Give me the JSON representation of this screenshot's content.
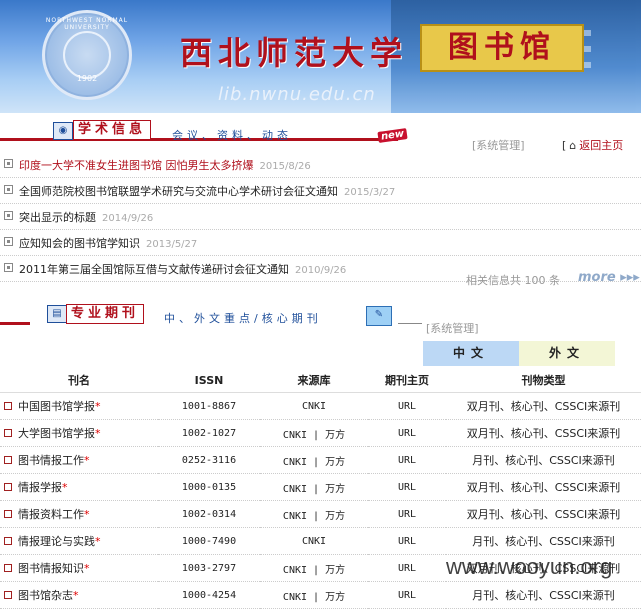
{
  "banner": {
    "title": "西北师范大学",
    "library": "图书馆",
    "url": "lib.nwnu.edu.cn",
    "seal_ring": "NORTHWEST NORMAL UNIVERSITY",
    "seal_year": "1902"
  },
  "news_section": {
    "title": "学术信息",
    "subtitle": "会议、资料、动态",
    "badge": "new",
    "sysadmin": "[系统管理]",
    "home_bracket": "[",
    "home": "返回主页",
    "items": [
      {
        "title": "印度一大学不准女生进图书馆 因怕男生太多挤爆",
        "date": "2015/8/26",
        "hot": true
      },
      {
        "title": "全国师范院校图书馆联盟学术研究与交流中心学术研讨会征文通知",
        "date": "2015/3/27",
        "hot": false
      },
      {
        "title": "突出显示的标题",
        "date": "2014/9/26",
        "hot": false
      },
      {
        "title": "应知知会的图书馆学知识",
        "date": "2013/5/27",
        "hot": false
      },
      {
        "title": "2011年第三届全国馆际互借与文献传递研讨会征文通知",
        "date": "2010/9/26",
        "hot": false
      }
    ],
    "total_label": "相关信息共 100 条",
    "more": "more ▸▸▸"
  },
  "journal_section": {
    "title": "专业期刊",
    "subtitle": "中、外文重点/核心期刊",
    "sysadmin": "[系统管理]",
    "tab_cn": "中文",
    "tab_en": "外文",
    "headers": [
      "刊名",
      "ISSN",
      "来源库",
      "期刊主页",
      "刊物类型"
    ],
    "rows": [
      {
        "name": "中国图书馆学报",
        "issn": "1001-8867",
        "src": "CNKI",
        "url": "URL",
        "type": "双月刊、核心刊、CSSCI来源刊"
      },
      {
        "name": "大学图书馆学报",
        "issn": "1002-1027",
        "src": "CNKI | 万方",
        "url": "URL",
        "type": "双月刊、核心刊、CSSCI来源刊"
      },
      {
        "name": "图书情报工作",
        "issn": "0252-3116",
        "src": "CNKI | 万方",
        "url": "URL",
        "type": "月刊、核心刊、CSSCI来源刊"
      },
      {
        "name": "情报学报",
        "issn": "1000-0135",
        "src": "CNKI | 万方",
        "url": "URL",
        "type": "双月刊、核心刊、CSSCI来源刊"
      },
      {
        "name": "情报资料工作",
        "issn": "1002-0314",
        "src": "CNKI | 万方",
        "url": "URL",
        "type": "双月刊、核心刊、CSSCI来源刊"
      },
      {
        "name": "情报理论与实践",
        "issn": "1000-7490",
        "src": "CNKI",
        "url": "URL",
        "type": "月刊、核心刊、CSSCI来源刊"
      },
      {
        "name": "图书情报知识",
        "issn": "1003-2797",
        "src": "CNKI | 万方",
        "url": "URL",
        "type": "双月刊、核心刊、CSSCI来源刊"
      },
      {
        "name": "图书馆杂志",
        "issn": "1000-4254",
        "src": "CNKI | 万方",
        "url": "URL",
        "type": "月刊、核心刊、CSSCI来源刊"
      }
    ]
  },
  "watermark": "www.wooyun.org"
}
